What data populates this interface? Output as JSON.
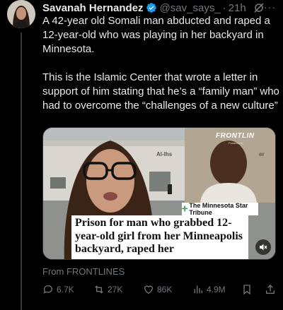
{
  "author": {
    "name": "Savanah Hernandez",
    "handle": "@sav_says_",
    "separator": "·",
    "time": "21h",
    "more": "···"
  },
  "tweet": {
    "paragraph1": "A 42-year old Somali man abducted and raped a 12-year-old who was playing in her backyard in Minnesota.",
    "paragraph2": "This is the Islamic Center that wrote a letter in support of him stating that he’s a “family man” who had to overcome the “challenges of a new culture”"
  },
  "media": {
    "logo": "FRONTLIN",
    "logo_sub": "Powered by",
    "sign_left": "Al-Ihs",
    "sign_right": "er",
    "source_label": "The Minnesota Star Tribune",
    "headline": "Prison for man who grabbed 12-year-old girl from her Minneapolis backyard, raped her",
    "sound_icon": "speaker-muted-icon"
  },
  "source": "From FRONTLINES",
  "actions": {
    "replies": "6.7K",
    "reposts": "27K",
    "likes": "86K",
    "views": "4.9M"
  },
  "colors": {
    "background": "#000000",
    "text": "#e7e9ea",
    "muted": "#71767b",
    "verified": "#1d9bf0"
  }
}
